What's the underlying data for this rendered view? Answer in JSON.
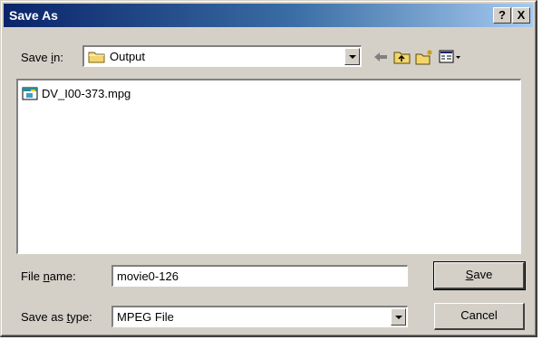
{
  "window": {
    "title": "Save As",
    "help_label": "?",
    "close_label": "X"
  },
  "save_in": {
    "label_prefix": "Save ",
    "label_hotkey": "i",
    "label_suffix": "n:",
    "folder": "Output"
  },
  "toolbar": {
    "icons": [
      "back-arrow-icon",
      "up-one-level-icon",
      "new-folder-icon",
      "view-menu-icon"
    ]
  },
  "files": [
    {
      "name": "DV_I00-373.mpg",
      "icon": "media-file-icon"
    }
  ],
  "file_name": {
    "label_prefix": "File ",
    "label_hotkey": "n",
    "label_suffix": "ame:",
    "value": "movie0-126"
  },
  "save_as_type": {
    "label_prefix": "Save as ",
    "label_hotkey": "t",
    "label_suffix": "ype:",
    "value": "MPEG File"
  },
  "buttons": {
    "save_hotkey": "S",
    "save_rest": "ave",
    "cancel": "Cancel"
  }
}
